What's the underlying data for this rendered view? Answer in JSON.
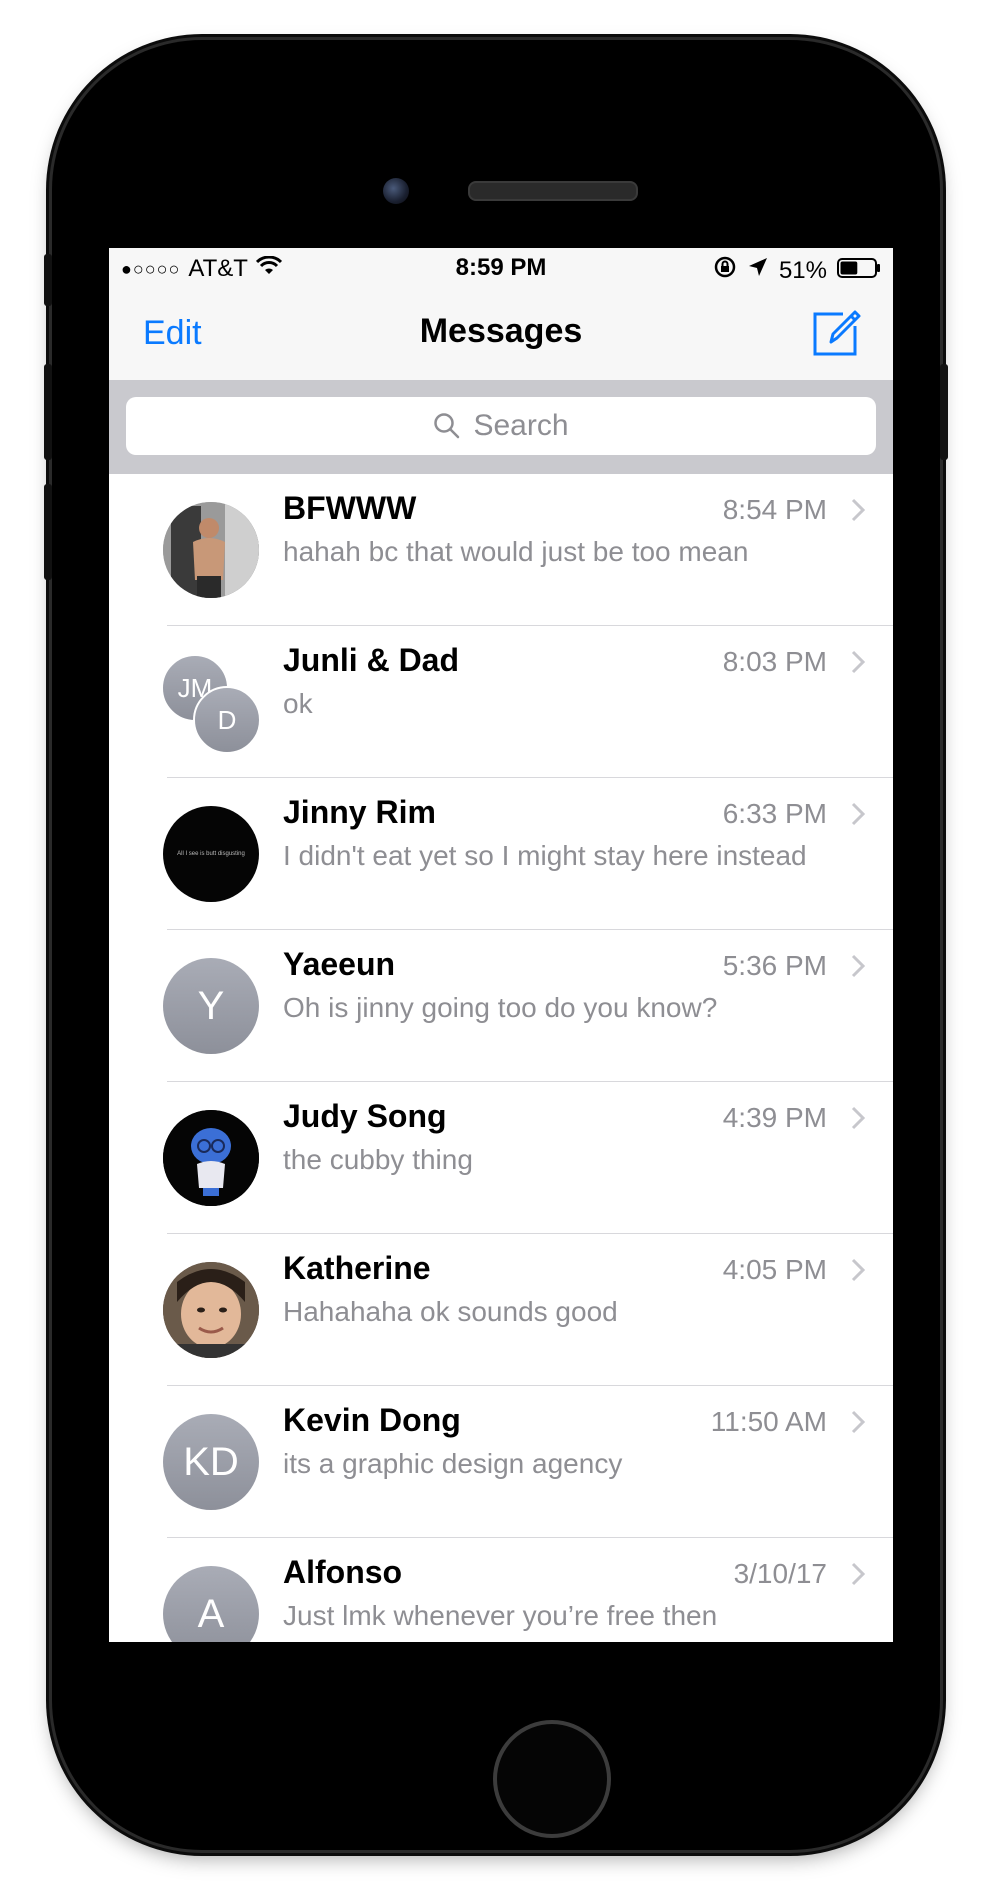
{
  "status_bar": {
    "signal": "●○○○○",
    "carrier": "AT&T",
    "time": "8:59 PM",
    "battery": "51%",
    "battery_level": 0.51
  },
  "nav": {
    "edit_label": "Edit",
    "title": "Messages"
  },
  "search": {
    "placeholder": "Search"
  },
  "conversations": [
    {
      "name": "BFWWW",
      "time": "8:54 PM",
      "preview": "hahah bc that would just be too mean"
    },
    {
      "name": "Junli & Dad",
      "time": "8:03 PM",
      "preview": "ok",
      "initials": [
        "JM",
        "D"
      ]
    },
    {
      "name": "Jinny Rim",
      "time": "6:33 PM",
      "preview": "I didn't eat yet so I might stay here instead",
      "avatar_caption": "All I see is butt disgusting"
    },
    {
      "name": "Yaeeun",
      "time": "5:36 PM",
      "preview": "Oh is jinny going too do you know?",
      "initials": "Y"
    },
    {
      "name": "Judy Song",
      "time": "4:39 PM",
      "preview": "the cubby thing"
    },
    {
      "name": "Katherine",
      "time": "4:05 PM",
      "preview": "Hahahaha ok sounds good"
    },
    {
      "name": "Kevin Dong",
      "time": "11:50 AM",
      "preview": "its a graphic design agency",
      "initials": "KD"
    },
    {
      "name": "Alfonso",
      "time": "3/10/17",
      "preview": "Just lmk whenever you’re free then",
      "initials": "A"
    }
  ],
  "colors": {
    "accent": "#0a7aff",
    "secondary_text": "#8e8e93",
    "search_bar_bg": "#c9c9ce",
    "nav_bg": "#f7f7f7"
  }
}
